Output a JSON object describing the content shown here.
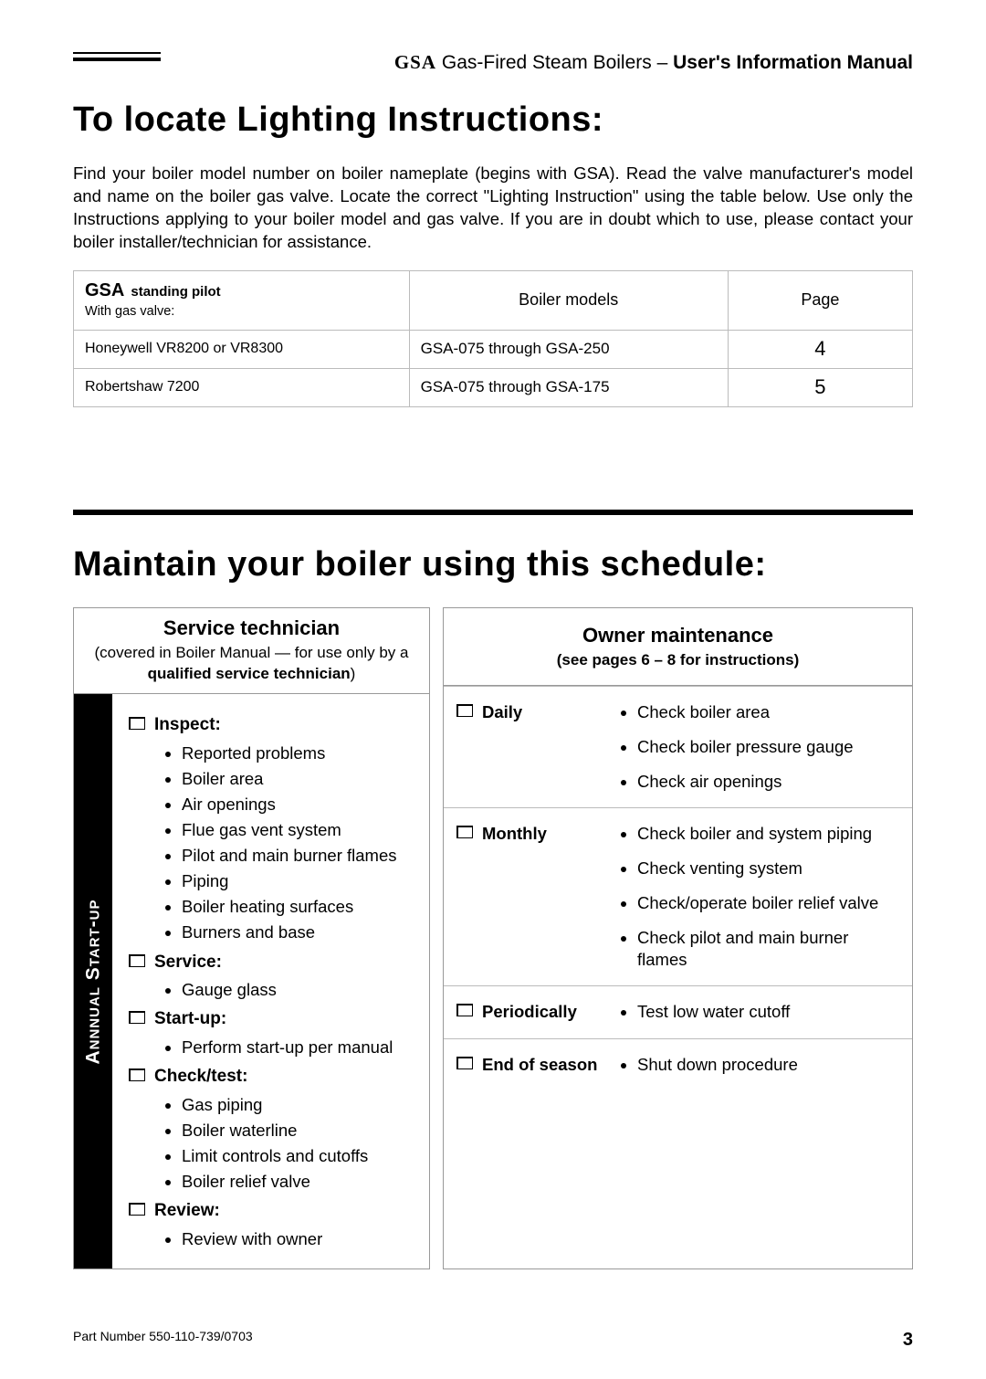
{
  "header": {
    "gsa": "GSA",
    "product": "Gas-Fired Steam Boilers",
    "dash": " – ",
    "manual": "User's Information Manual"
  },
  "section1": {
    "title": "To locate Lighting Instructions:",
    "intro": "Find your boiler model number on boiler nameplate (begins with GSA). Read the valve manufacturer's model and name on the boiler gas valve. Locate the correct \"Lighting Instruction\" using the table below. Use only the Instructions applying to your boiler model and gas valve. If you are in doubt which to use, please contact your boiler installer/technician for assistance.",
    "table": {
      "head": {
        "col1a": "GSA",
        "col1b": "standing pilot",
        "col1c": "With gas valve:",
        "col2": "Boiler models",
        "col3": "Page"
      },
      "rows": [
        {
          "valve": "Honeywell VR8200 or VR8300",
          "models": "GSA-075 through GSA-250",
          "page": "4"
        },
        {
          "valve": "Robertshaw 7200",
          "models": "GSA-075 through GSA-175",
          "page": "5"
        }
      ]
    }
  },
  "section2": {
    "title": "Maintain your boiler using this schedule:",
    "left": {
      "heading": "Service technician",
      "sub_pre": "(covered in Boiler Manual — for use only by a ",
      "sub_bold": "qualified service technician",
      "sub_post": ")",
      "sidebar": "Annnual  Start-up",
      "groups": [
        {
          "label": "Inspect:",
          "items": [
            "Reported problems",
            "Boiler area",
            "Air openings",
            "Flue gas vent system",
            "Pilot and main burner flames",
            "Piping",
            "Boiler heating surfaces",
            "Burners and base"
          ]
        },
        {
          "label": "Service:",
          "items": [
            "Gauge glass"
          ]
        },
        {
          "label": "Start-up:",
          "items": [
            "Perform start-up per manual"
          ]
        },
        {
          "label": "Check/test:",
          "items": [
            "Gas piping",
            "Boiler waterline",
            "Limit controls and cutoffs",
            "Boiler relief valve"
          ]
        },
        {
          "label": "Review:",
          "items": [
            "Review with owner"
          ]
        }
      ]
    },
    "right": {
      "heading": "Owner maintenance",
      "sub": "(see pages 6 – 8 for instructions)",
      "rows": [
        {
          "period": "Daily",
          "items": [
            "Check boiler area",
            "Check boiler pressure gauge",
            "Check air openings"
          ]
        },
        {
          "period": "Monthly",
          "items": [
            "Check boiler and system piping",
            "Check venting system",
            "Check/operate boiler relief valve",
            "Check pilot and main burner flames"
          ]
        },
        {
          "period": "Periodically",
          "items": [
            "Test low water cutoff"
          ]
        },
        {
          "period": "End of season",
          "items": [
            "Shut down procedure"
          ]
        }
      ]
    }
  },
  "footer": {
    "part": "Part Number 550-110-739/0703",
    "page": "3"
  }
}
